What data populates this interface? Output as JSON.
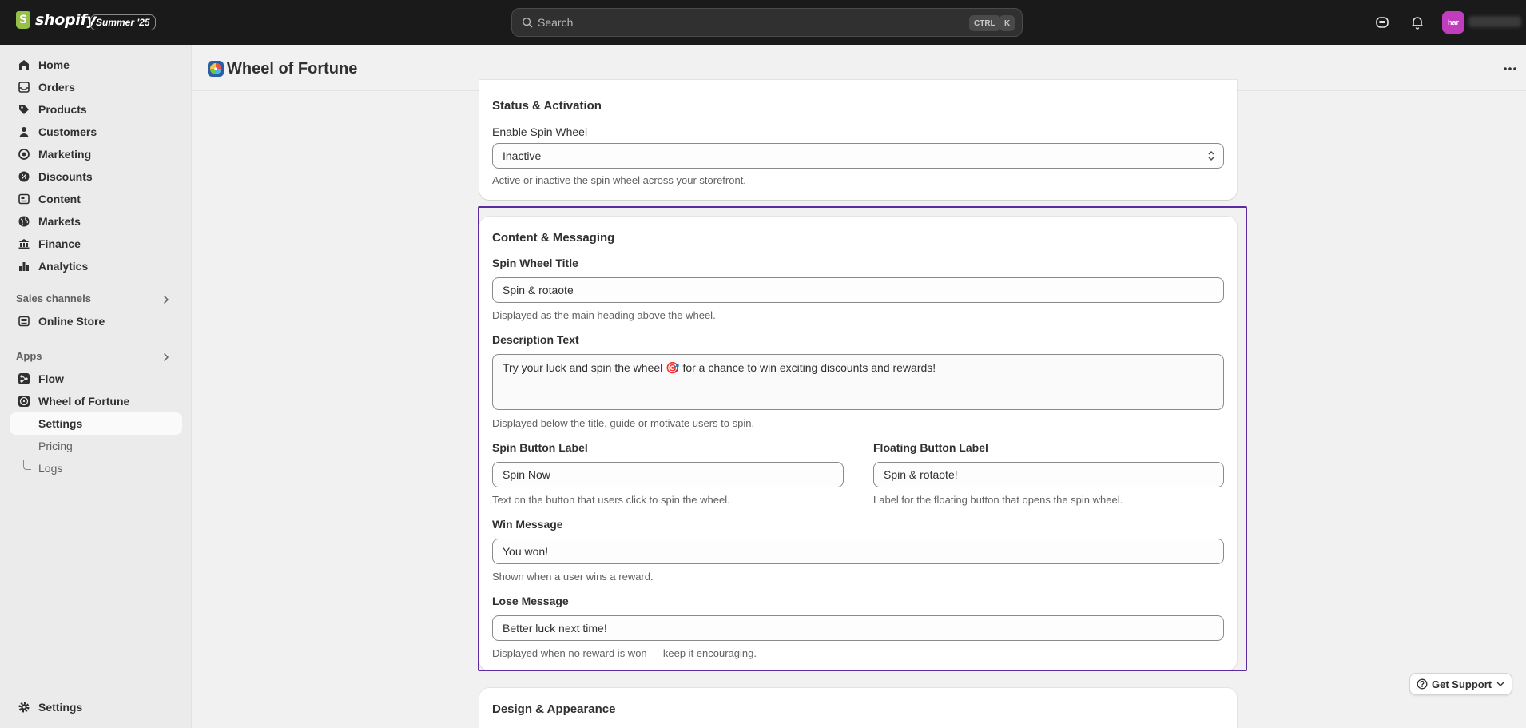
{
  "topbar": {
    "logo_text": "shopify",
    "edition_badge": "Summer '25",
    "search_placeholder": "Search",
    "shortcut_ctrl": "CTRL",
    "shortcut_k": "K",
    "avatar_initials": "har"
  },
  "sidebar": {
    "items": [
      {
        "label": "Home",
        "icon": "home-icon"
      },
      {
        "label": "Orders",
        "icon": "inbox-icon"
      },
      {
        "label": "Products",
        "icon": "tag-icon"
      },
      {
        "label": "Customers",
        "icon": "person-icon"
      },
      {
        "label": "Marketing",
        "icon": "target-icon"
      },
      {
        "label": "Discounts",
        "icon": "discount-icon"
      },
      {
        "label": "Content",
        "icon": "content-icon"
      },
      {
        "label": "Markets",
        "icon": "globe-icon"
      },
      {
        "label": "Finance",
        "icon": "bank-icon"
      },
      {
        "label": "Analytics",
        "icon": "bar-chart-icon"
      }
    ],
    "sales_channels_label": "Sales channels",
    "online_store": "Online Store",
    "apps_label": "Apps",
    "flow": "Flow",
    "wheel_of_fortune": "Wheel of Fortune",
    "sub_items": [
      "Settings",
      "Pricing",
      "Logs"
    ],
    "bottom_settings": "Settings"
  },
  "page": {
    "title": "Wheel of Fortune"
  },
  "status_card": {
    "title": "Status & Activation",
    "enable_label": "Enable Spin Wheel",
    "enable_value": "Inactive",
    "enable_help": "Active or inactive the spin wheel across your storefront."
  },
  "content_card": {
    "title": "Content & Messaging",
    "spin_title_label": "Spin Wheel Title",
    "spin_title_value": "Spin & rotaote",
    "spin_title_help": "Displayed as the main heading above the wheel.",
    "description_label": "Description Text",
    "description_value": "Try your luck and spin the wheel 🎯 for a chance to win exciting discounts and rewards!",
    "description_help": "Displayed below the title, guide or motivate users to spin.",
    "spin_button_label": "Spin Button Label",
    "spin_button_value": "Spin Now",
    "spin_button_help": "Text on the button that users click to spin the wheel.",
    "floating_button_label": "Floating Button Label",
    "floating_button_value": "Spin & rotaote!",
    "floating_button_help": "Label for the floating button that opens the spin wheel.",
    "win_label": "Win Message",
    "win_value": "You won!",
    "win_help": "Shown when a user wins a reward.",
    "lose_label": "Lose Message",
    "lose_value": "Better luck next time!",
    "lose_help": "Displayed when no reward is won — keep it encouraging."
  },
  "design_card": {
    "title": "Design & Appearance"
  },
  "support": {
    "label": "Get Support"
  }
}
